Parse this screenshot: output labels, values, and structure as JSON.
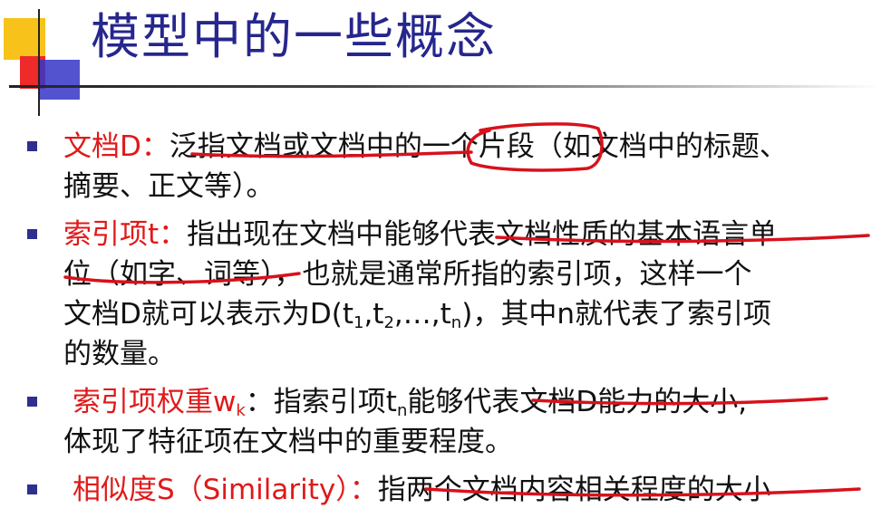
{
  "title": "模型中的一些概念",
  "items": [
    {
      "term": "文档D：",
      "line1": "泛指文档或文档中的一个片段（如文档中的标题、",
      "line2": "摘要、正文等）。"
    },
    {
      "term": "索引项t：",
      "line1": "指出现在文档中能够代表文档性质的基本语言单",
      "line2": "位（如字、词等），也就是通常所指的索引项，这样一个",
      "line3_a": "文档D就可以表示为D(t",
      "line3_s1": "1",
      "line3_b": ",t",
      "line3_s2": "2",
      "line3_c": ",…,t",
      "line3_s3": "n",
      "line3_d": ")，其中n就代表了索引项",
      "line4": "的数量。"
    },
    {
      "term_a": "索引项权重w",
      "term_sub": "k",
      "term_b": "：",
      "line1_a": "指索引项t",
      "line1_sub": "n",
      "line1_b": "能够代表文档D能力的大小,",
      "line2": "体现了特征项在文档中的重要程度。"
    },
    {
      "term": "相似度S（Similarity）：",
      "line1": "指两个文档内容相关程度的大小"
    }
  ],
  "colors": {
    "title": "#26268e",
    "term": "#e01919",
    "bullet": "#2f2f8f",
    "annotation": "#d8111b"
  }
}
